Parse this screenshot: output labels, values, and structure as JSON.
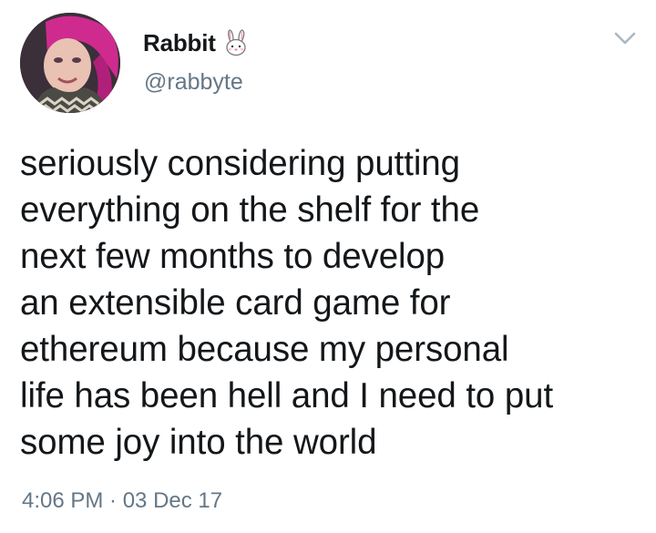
{
  "tweet": {
    "display_name": "Rabbit",
    "name_emoji": "rabbit-face-icon",
    "handle": "@rabbyte",
    "text": "seriously considering putting\neverything on the shelf for the\nnext few months to develop\nan extensible card game for\nethereum because my personal\nlife has been hell and I need to put\nsome joy into the world",
    "timestamp": "4:06 PM · 03 Dec 17",
    "menu_icon": "chevron-down-icon"
  },
  "colors": {
    "text_primary": "#14171a",
    "text_secondary": "#657786",
    "chevron": "#aab8c2",
    "avatar_hair": "#d12d8f"
  }
}
